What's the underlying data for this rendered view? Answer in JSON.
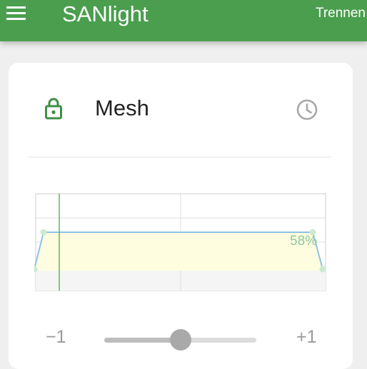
{
  "appbar": {
    "title": "SANlight",
    "disconnect_label": "Trennen",
    "color": "#4a9e4e"
  },
  "card": {
    "group_name": "Mesh",
    "lock_icon": "lock-icon",
    "schedule_icon": "clock-icon"
  },
  "chart_data": {
    "type": "line",
    "values_percent": [
      0,
      58,
      58,
      58,
      0
    ],
    "point_label": "58%",
    "grid": true,
    "line_color": "#8cc3e6",
    "fill_color": "#fffde0",
    "cursor_color": "#5cb85c"
  },
  "slider": {
    "min_label": "−1",
    "max_label": "+1",
    "min": -1,
    "max": 1,
    "value": 0
  }
}
